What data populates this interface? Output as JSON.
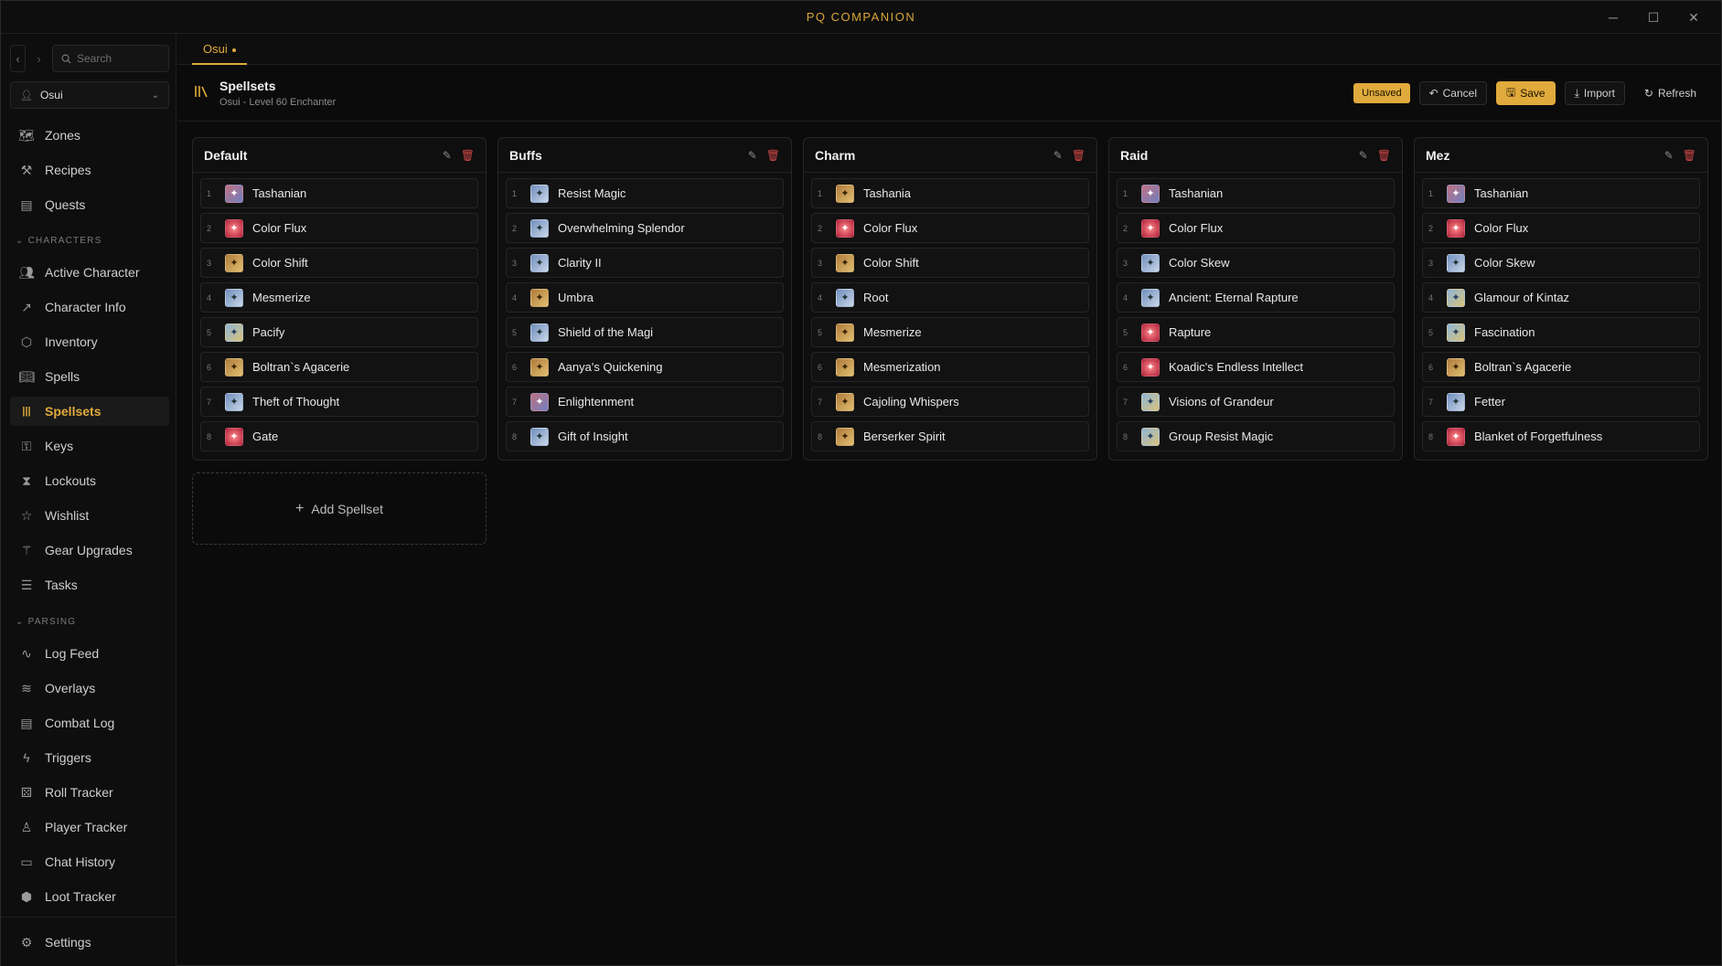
{
  "app": {
    "title": "PQ COMPANION"
  },
  "window_controls": {
    "minimize": "─",
    "maximize": "☐",
    "close": "✕"
  },
  "sidebar": {
    "search_placeholder": "Search",
    "character": "Osui",
    "top_items": [
      {
        "label": "Zones",
        "icon": "map-icon"
      },
      {
        "label": "Recipes",
        "icon": "hammer-icon"
      },
      {
        "label": "Quests",
        "icon": "scroll-icon"
      }
    ],
    "sections": [
      {
        "label": "CHARACTERS",
        "items": [
          {
            "label": "Active Character",
            "icon": "users-icon"
          },
          {
            "label": "Character Info",
            "icon": "trend-icon"
          },
          {
            "label": "Inventory",
            "icon": "box-icon"
          },
          {
            "label": "Spells",
            "icon": "book-icon"
          },
          {
            "label": "Spellsets",
            "icon": "library-icon",
            "active": true
          },
          {
            "label": "Keys",
            "icon": "key-icon"
          },
          {
            "label": "Lockouts",
            "icon": "hourglass-icon"
          },
          {
            "label": "Wishlist",
            "icon": "star-icon"
          },
          {
            "label": "Gear Upgrades",
            "icon": "wand-icon"
          },
          {
            "label": "Tasks",
            "icon": "checklist-icon"
          }
        ]
      },
      {
        "label": "PARSING",
        "items": [
          {
            "label": "Log Feed",
            "icon": "pulse-icon"
          },
          {
            "label": "Overlays",
            "icon": "layers-icon"
          },
          {
            "label": "Combat Log",
            "icon": "scroll-icon"
          },
          {
            "label": "Triggers",
            "icon": "bolt-icon"
          },
          {
            "label": "Roll Tracker",
            "icon": "dice-icon"
          },
          {
            "label": "Player Tracker",
            "icon": "user-search-icon"
          },
          {
            "label": "Chat History",
            "icon": "chat-icon"
          },
          {
            "label": "Loot Tracker",
            "icon": "package-icon"
          }
        ]
      }
    ],
    "settings": {
      "label": "Settings",
      "icon": "gear-icon"
    }
  },
  "tabs": [
    {
      "label": "Osui",
      "modified": true
    }
  ],
  "page": {
    "title": "Spellsets",
    "subtitle": "Osui - Level 60 Enchanter",
    "status": "Unsaved",
    "actions": {
      "cancel": "Cancel",
      "save": "Save",
      "import": "Import",
      "refresh": "Refresh"
    }
  },
  "spellsets": [
    {
      "name": "Default",
      "spells": [
        "Tashanian",
        "Color Flux",
        "Color Shift",
        "Mesmerize",
        "Pacify",
        "Boltran`s Agacerie",
        "Theft of Thought",
        "Gate"
      ]
    },
    {
      "name": "Buffs",
      "spells": [
        "Resist Magic",
        "Overwhelming Splendor",
        "Clarity II",
        "Umbra",
        "Shield of the Magi",
        "Aanya's Quickening",
        "Enlightenment",
        "Gift of Insight"
      ]
    },
    {
      "name": "Charm",
      "spells": [
        "Tashania",
        "Color Flux",
        "Color Shift",
        "Root",
        "Mesmerize",
        "Mesmerization",
        "Cajoling Whispers",
        "Berserker Spirit"
      ]
    },
    {
      "name": "Raid",
      "spells": [
        "Tashanian",
        "Color Flux",
        "Color Skew",
        "Ancient: Eternal Rapture",
        "Rapture",
        "Koadic's Endless Intellect",
        "Visions of Grandeur",
        "Group Resist Magic"
      ]
    },
    {
      "name": "Mez",
      "spells": [
        "Tashanian",
        "Color Flux",
        "Color Skew",
        "Glamour of Kintaz",
        "Fascination",
        "Boltran`s Agacerie",
        "Fetter",
        "Blanket of Forgetfulness"
      ]
    }
  ],
  "slot_numbers": [
    "1",
    "2",
    "3",
    "4",
    "5",
    "6",
    "7",
    "8"
  ],
  "add_spellset_label": "Add Spellset",
  "colors": {
    "accent": "#e0aa3c",
    "danger": "#d24848",
    "background": "#0b0b0b"
  }
}
